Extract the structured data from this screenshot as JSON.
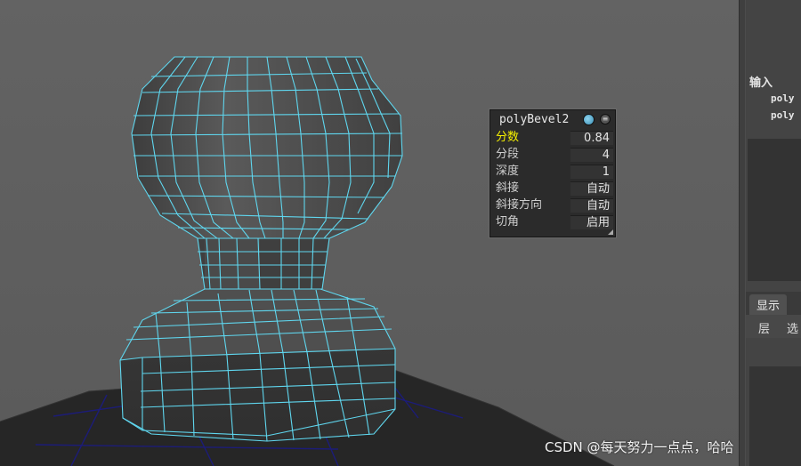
{
  "hud": {
    "title": "polyBevel2",
    "rows": [
      {
        "label": "分数",
        "value": "0.84"
      },
      {
        "label": "分段",
        "value": "4"
      },
      {
        "label": "深度",
        "value": "1"
      },
      {
        "label": "斜接",
        "value": "自动"
      },
      {
        "label": "斜接方向",
        "value": "自动"
      },
      {
        "label": "切角",
        "value": "启用"
      }
    ]
  },
  "channel_box": {
    "inputs_label": "输入",
    "input_nodes": [
      "poly",
      "poly"
    ]
  },
  "layer_editor": {
    "tab_label": "显示",
    "menu_items": [
      "层",
      "选"
    ]
  },
  "watermark": "CSDN @每天努力一点点，哈哈",
  "colors": {
    "wireframe": "#5fd6ee",
    "active_label": "#f5f000",
    "viewport_bg": "#5f5f5f"
  }
}
